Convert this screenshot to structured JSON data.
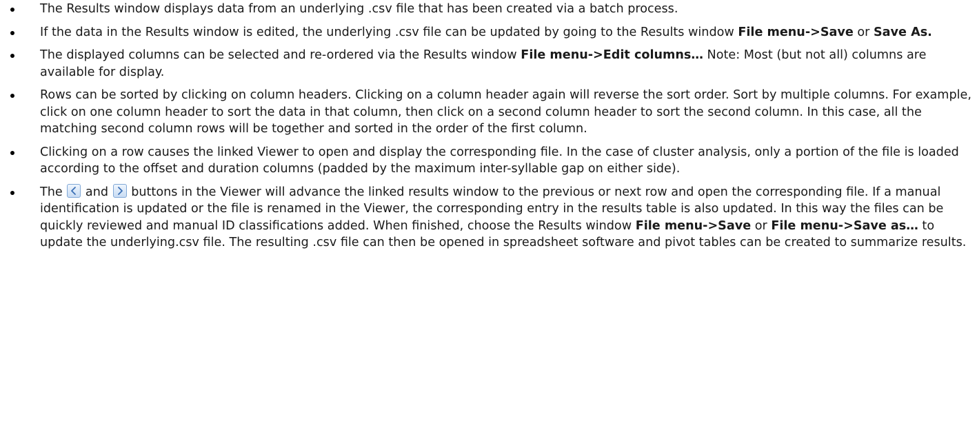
{
  "bullets": {
    "b1": {
      "text": "The Results window displays data from an underlying .csv file that has been created via a batch process."
    },
    "b2": {
      "t1": "If the data in the Results window is edited, the underlying .csv file can be updated by going to the Results window ",
      "bold1": "File menu->Save",
      "t2": " or ",
      "bold2": "Save As."
    },
    "b3": {
      "t1": "The displayed columns can be selected and re-ordered via the Results window ",
      "bold1": "File menu->Edit columns…",
      "t2": " Note: Most (but not all) columns are available for display."
    },
    "b4": {
      "text": "Rows can be sorted by clicking on column headers. Clicking on a column header again will reverse the sort order. Sort by multiple columns. For example, click on one column header to sort the data in that column, then click on a second column header to sort the second column. In this case, all the matching second column rows will be together and sorted in the order of the first column."
    },
    "b5": {
      "text": "Clicking on a row causes the linked Viewer to open and display the corresponding file. In the case of cluster analysis, only a portion of the file is loaded according to the offset and duration columns (padded by the maximum inter-syllable gap on either side)."
    },
    "b6": {
      "t1": "The ",
      "t2": " and ",
      "t3": " buttons in the Viewer will advance the linked results window to the previous or next row and open the corresponding file. If a manual identification is updated or the file is renamed in the Viewer, the corresponding entry in the results table is also updated. In this way the files can be quickly reviewed and manual ID classifications added. When finished, choose the Results window ",
      "bold1": "File menu->Save",
      "t4": " or ",
      "bold2": "File menu->Save as…",
      "t5": " to update the underlying.csv file. The resulting .csv file can then be opened in spreadsheet software and pivot tables can be created to summarize results."
    }
  },
  "icons": {
    "prev": "chevron-left-icon",
    "next": "chevron-right-icon",
    "button_border": "#7fa7d6",
    "button_fill": "#dce9f8",
    "arrow_color": "#3a6fb5"
  }
}
